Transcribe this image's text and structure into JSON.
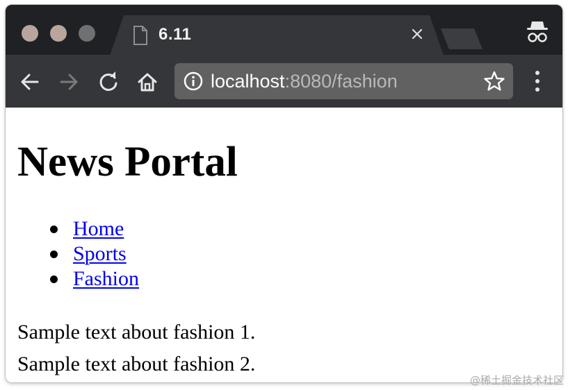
{
  "browser": {
    "tab": {
      "title": "6.11"
    },
    "address_bar": {
      "host": "localhost",
      "path": ":8080/fashion"
    },
    "icons": {
      "window_close": "window-close-icon",
      "window_minimize": "window-minimize-icon",
      "window_maximize": "window-maximize-icon",
      "tab_file": "file-icon",
      "tab_close": "close-icon",
      "incognito": "incognito-icon",
      "back": "back-arrow-icon",
      "forward": "forward-arrow-icon",
      "reload": "reload-icon",
      "home": "home-icon",
      "site_info": "info-icon",
      "bookmark": "star-icon",
      "menu": "kebab-menu-icon"
    },
    "colors": {
      "tabstrip": "#202124",
      "toolbar": "#35363a",
      "omnibox": "#616161"
    }
  },
  "page": {
    "title": "News Portal",
    "nav": [
      {
        "label": "Home"
      },
      {
        "label": "Sports"
      },
      {
        "label": "Fashion"
      }
    ],
    "paragraphs": [
      "Sample text about fashion 1.",
      "Sample text about fashion 2."
    ],
    "link_color": "#0000ee"
  },
  "watermark": "@稀土掘金技术社区"
}
